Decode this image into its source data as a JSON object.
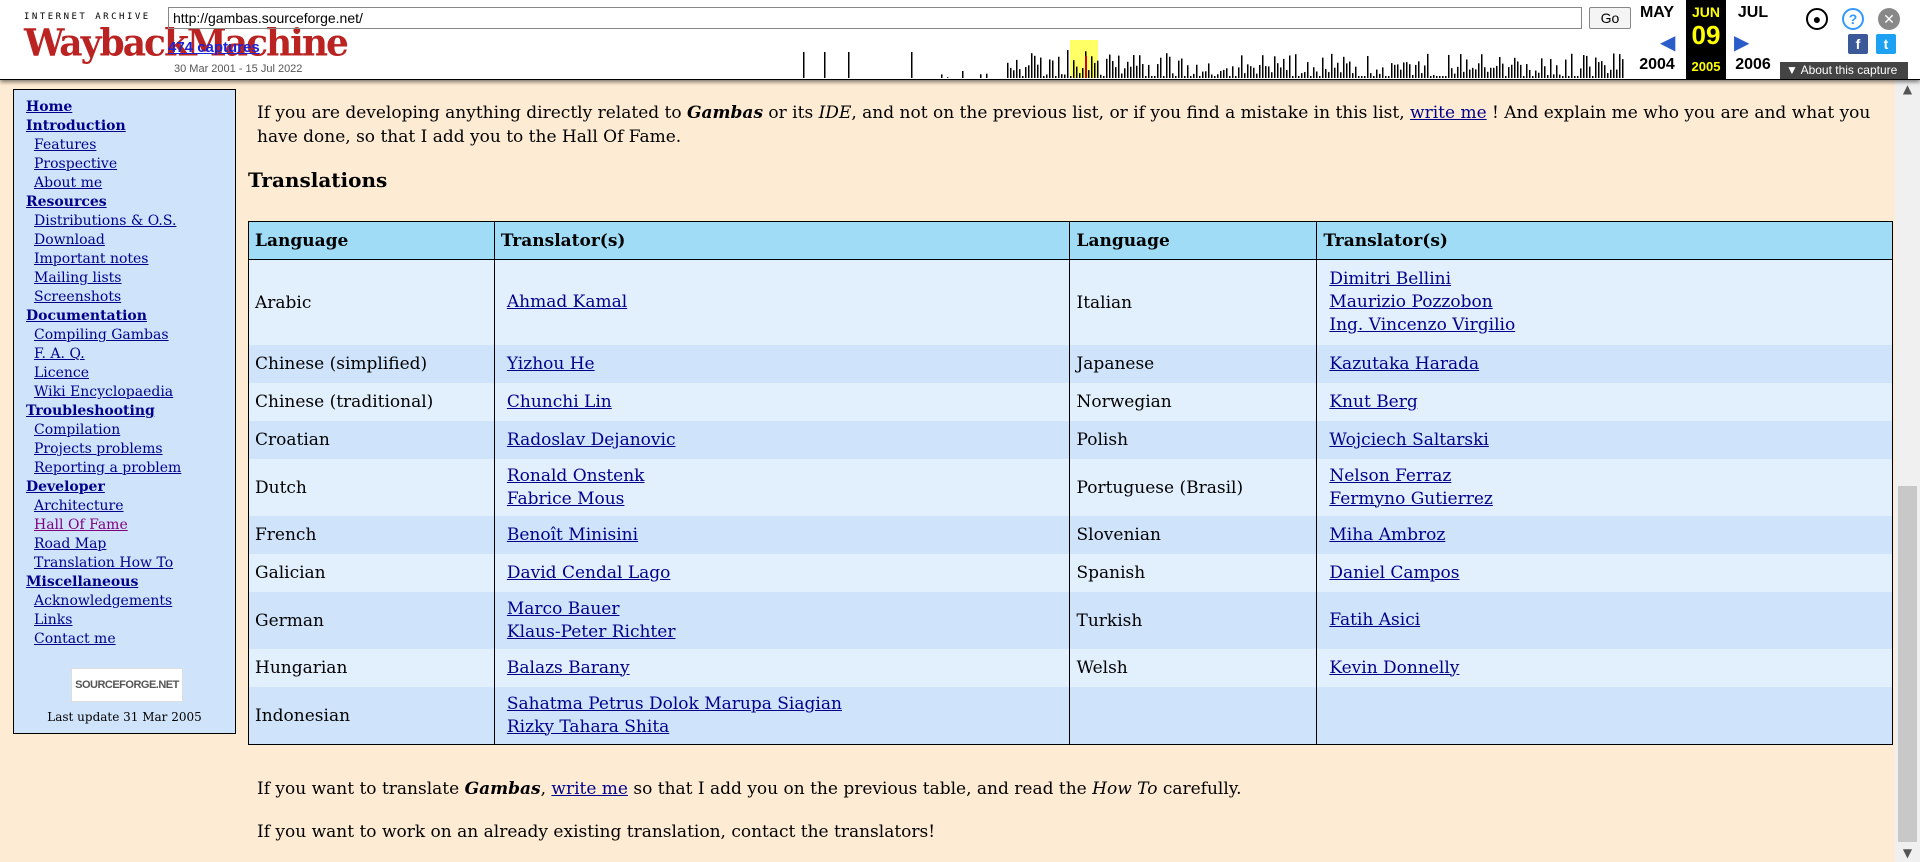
{
  "wayback": {
    "logo_top": "INTERNET ARCHIVE",
    "logo_main": "WaybackMachine",
    "url": "http://gambas.sourceforge.net/",
    "go_label": "Go",
    "captures": "474 captures",
    "range": "30 Mar 2001 - 15 Jul 2022",
    "prev_month": "MAY",
    "prev_year": "2004",
    "cur_month": "JUN",
    "cur_day": "09",
    "cur_year": "2005",
    "next_month": "JUL",
    "next_year": "2006",
    "about": "About this capture"
  },
  "sidebar": {
    "items": [
      {
        "label": "Home",
        "type": "sec"
      },
      {
        "label": "Introduction",
        "type": "sec"
      },
      {
        "label": "Features",
        "type": "sub"
      },
      {
        "label": "Prospective",
        "type": "sub"
      },
      {
        "label": "About me",
        "type": "sub"
      },
      {
        "label": "Resources",
        "type": "sec"
      },
      {
        "label": "Distributions & O.S.",
        "type": "sub"
      },
      {
        "label": "Download",
        "type": "sub"
      },
      {
        "label": "Important notes",
        "type": "sub"
      },
      {
        "label": "Mailing lists",
        "type": "sub"
      },
      {
        "label": "Screenshots",
        "type": "sub"
      },
      {
        "label": "Documentation",
        "type": "sec"
      },
      {
        "label": "Compiling Gambas",
        "type": "sub"
      },
      {
        "label": "F. A. Q.",
        "type": "sub"
      },
      {
        "label": "Licence",
        "type": "sub"
      },
      {
        "label": "Wiki Encyclopaedia",
        "type": "sub"
      },
      {
        "label": "Troubleshooting",
        "type": "sec"
      },
      {
        "label": "Compilation",
        "type": "sub"
      },
      {
        "label": "Projects problems",
        "type": "sub"
      },
      {
        "label": "Reporting a problem",
        "type": "sub"
      },
      {
        "label": "Developer",
        "type": "sec"
      },
      {
        "label": "Architecture",
        "type": "sub"
      },
      {
        "label": "Hall Of Fame",
        "type": "sub visited"
      },
      {
        "label": "Road Map",
        "type": "sub"
      },
      {
        "label": "Translation How To",
        "type": "sub"
      },
      {
        "label": "Miscellaneous",
        "type": "sec"
      },
      {
        "label": "Acknowledgements",
        "type": "sub"
      },
      {
        "label": "Links",
        "type": "sub"
      },
      {
        "label": "Contact me",
        "type": "sub"
      }
    ],
    "sourceforge": "SOURCEFORGE.NET",
    "last_update": "Last update 31 Mar 2005"
  },
  "main": {
    "intro_1": "If you are developing anything directly related to ",
    "intro_gambas": "Gambas",
    "intro_2": " or its ",
    "intro_ide": "IDE",
    "intro_3": ", and not on the previous list, or if you find a mistake in this list, ",
    "intro_link": "write me",
    "intro_4": " ! And explain me who you are and what you have done, so that I add you to the Hall Of Fame.",
    "heading": "Translations",
    "headers": [
      "Language",
      "Translator(s)",
      "Language",
      "Translator(s)"
    ],
    "rows": [
      {
        "l1": "Arabic",
        "t1": [
          "Ahmad Kamal"
        ],
        "l2": "Italian",
        "t2": [
          "Dimitri Bellini",
          "Maurizio Pozzobon",
          "Ing. Vincenzo Virgilio"
        ]
      },
      {
        "l1": "Chinese (simplified)",
        "t1": [
          "Yizhou He"
        ],
        "l2": "Japanese",
        "t2": [
          "Kazutaka Harada"
        ]
      },
      {
        "l1": "Chinese (traditional)",
        "t1": [
          "Chunchi Lin"
        ],
        "l2": "Norwegian",
        "t2": [
          "Knut Berg"
        ]
      },
      {
        "l1": "Croatian",
        "t1": [
          "Radoslav Dejanovic"
        ],
        "l2": "Polish",
        "t2": [
          "Wojciech Saltarski"
        ]
      },
      {
        "l1": "Dutch",
        "t1": [
          "Ronald Onstenk",
          "Fabrice Mous"
        ],
        "l2": "Portuguese (Brasil)",
        "t2": [
          "Nelson Ferraz",
          "Fermyno Gutierrez"
        ]
      },
      {
        "l1": "French",
        "t1": [
          "Benoît Minisini"
        ],
        "l2": "Slovenian",
        "t2": [
          "Miha Ambroz"
        ]
      },
      {
        "l1": "Galician",
        "t1": [
          "David Cendal Lago"
        ],
        "l2": "Spanish",
        "t2": [
          "Daniel Campos"
        ]
      },
      {
        "l1": "German",
        "t1": [
          "Marco Bauer",
          "Klaus-Peter Richter"
        ],
        "l2": "Turkish",
        "t2": [
          "Fatih Asici"
        ]
      },
      {
        "l1": "Hungarian",
        "t1": [
          "Balazs Barany"
        ],
        "l2": "Welsh",
        "t2": [
          "Kevin Donnelly"
        ]
      },
      {
        "l1": "Indonesian",
        "t1": [
          "Sahatma Petrus Dolok Marupa Siagian",
          "Rizky Tahara Shita"
        ],
        "l2": "",
        "t2": []
      }
    ],
    "outro1_a": "If you want to translate ",
    "outro1_gambas": "Gambas",
    "outro1_b": ", ",
    "outro1_link": "write me",
    "outro1_c": " so that I add you on the previous table, and read the ",
    "outro1_howto": "How To",
    "outro1_d": " carefully.",
    "outro2": "If you want to work on an already existing translation, contact the translators!"
  }
}
